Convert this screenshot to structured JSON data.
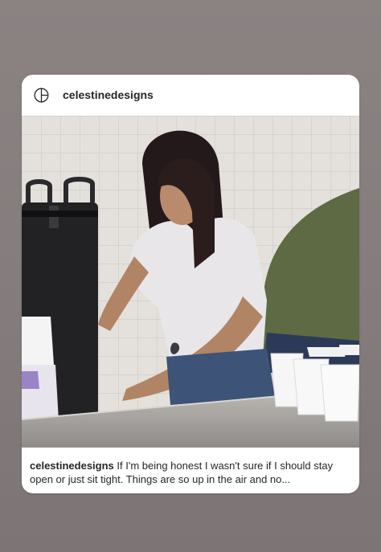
{
  "post": {
    "username": "celestinedesigns",
    "logo_icon": "celestine-designs-logo",
    "image_alt": "Woman in a white t-shirt pouring from a black beverage dispenser into white cups at a stainless steel counter, with another person in a green shirt beside her",
    "caption_username": "celestinedesigns",
    "caption_text": " If I'm being honest I wasn't sure if I should stay open or just sit tight. Things are so up in the air and no..."
  },
  "colors": {
    "background": "#857d7d",
    "card": "#ffffff",
    "text": "#262626"
  }
}
